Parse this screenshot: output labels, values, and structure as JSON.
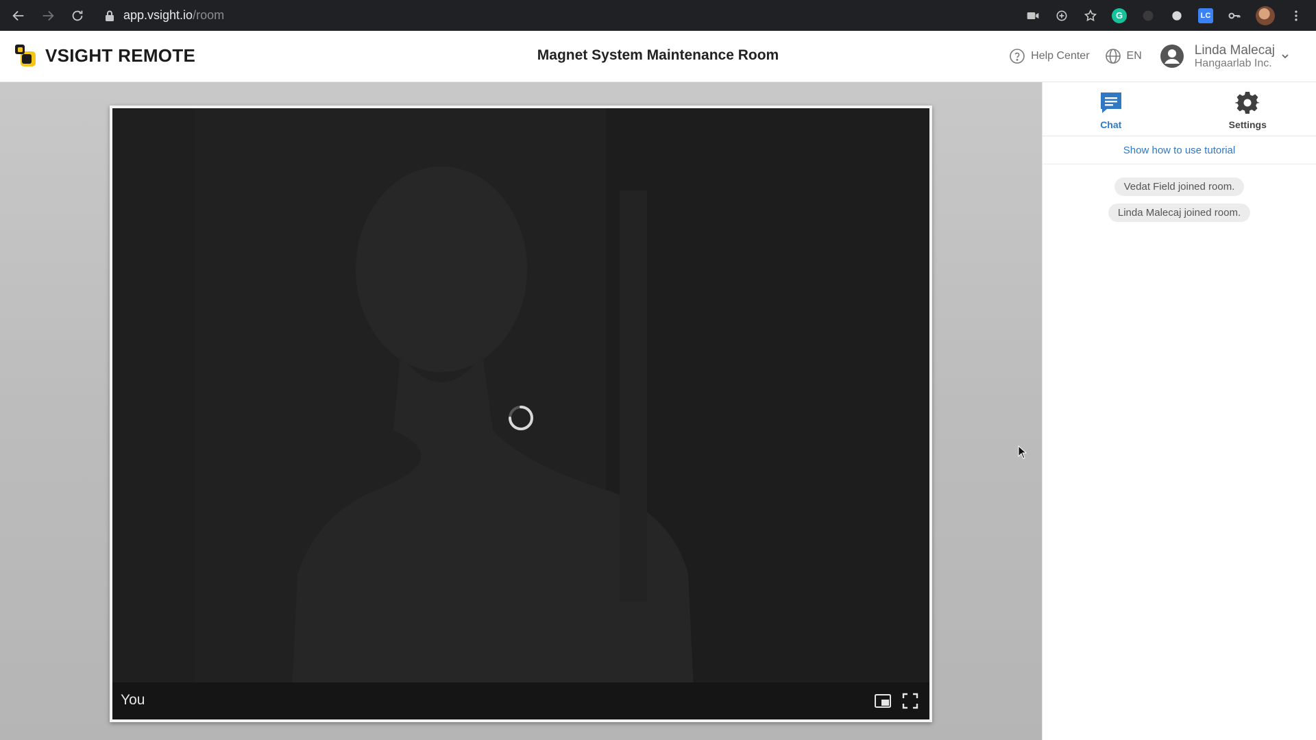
{
  "browser": {
    "url_host": "app.vsight.io",
    "url_path": "/room"
  },
  "header": {
    "logo_text": "VSIGHT REMOTE",
    "room_title": "Magnet System Maintenance Room",
    "help_label": "Help Center",
    "language": "EN",
    "user_name": "Linda Malecaj",
    "user_org": "Hangaarlab Inc."
  },
  "video": {
    "participant_label": "You"
  },
  "panel": {
    "tabs": [
      {
        "label": "Chat",
        "icon": "chat-icon",
        "active": true
      },
      {
        "label": "Settings",
        "icon": "gear-icon",
        "active": false
      }
    ],
    "tutorial_link": "Show how to use tutorial",
    "messages": [
      {
        "text": "Vedat Field joined room."
      },
      {
        "text": "Linda Malecaj joined room."
      }
    ]
  },
  "colors": {
    "accent": "#2f79c4",
    "logo_yellow": "#f5c518",
    "browser_bar": "#202124"
  }
}
